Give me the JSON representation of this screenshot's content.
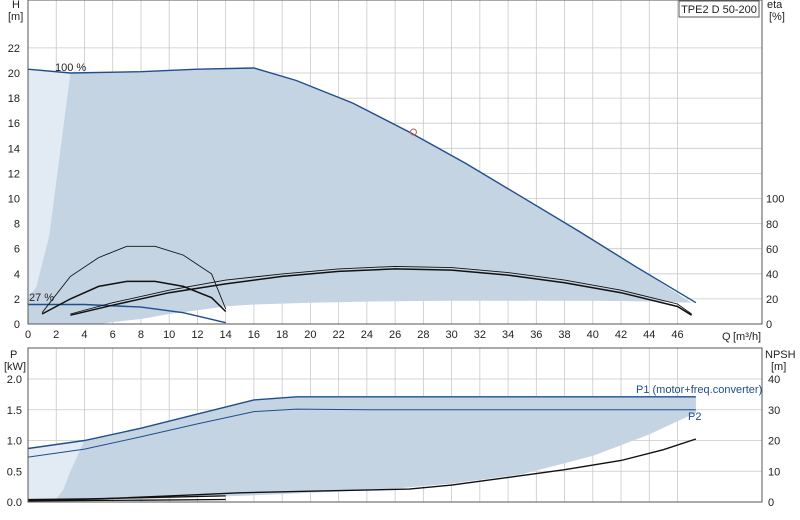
{
  "chart_data": [
    {
      "type": "line",
      "name": "head-efficiency",
      "title": "TPE2 D 50-200",
      "ylabel": "H",
      "yunit": "[m]",
      "y2label": "eta",
      "y2unit": "[%]",
      "xlabel": "Q",
      "xunit": "[m³/h]",
      "xlim": [
        0,
        48
      ],
      "ylim": [
        0,
        24
      ],
      "y2lim": [
        0,
        100
      ],
      "xticks": [
        "0",
        "2",
        "4",
        "6",
        "8",
        "10",
        "12",
        "14",
        "16",
        "18",
        "20",
        "22",
        "24",
        "26",
        "28",
        "30",
        "32",
        "34",
        "36",
        "38",
        "40",
        "42",
        "44",
        "46"
      ],
      "yticks": [
        "0",
        "2",
        "4",
        "6",
        "8",
        "10",
        "12",
        "14",
        "16",
        "18",
        "20",
        "22"
      ],
      "y2ticks": [
        "0",
        "20",
        "40",
        "60",
        "80",
        "100"
      ],
      "grid": true,
      "annotations": {
        "curve_max": "100 %",
        "curve_min": "27 %"
      },
      "colors": {
        "head": "#1f4e8c",
        "area": "#c5d4e3",
        "area_light": "#e2ebf3",
        "eta": "#111111",
        "op_point": "#d9534f"
      },
      "operating_area": [
        [
          0,
          20.3
        ],
        [
          3,
          20
        ],
        [
          8,
          20.1
        ],
        [
          12,
          20.3
        ],
        [
          16,
          20.4
        ],
        [
          19,
          19.4
        ],
        [
          23,
          17.6
        ],
        [
          27,
          15.3
        ],
        [
          31,
          12.8
        ],
        [
          35,
          10.1
        ],
        [
          39,
          7.4
        ],
        [
          43,
          4.6
        ],
        [
          47,
          1.7
        ],
        [
          47,
          1.7
        ],
        [
          44,
          1.8
        ],
        [
          40,
          1.85
        ],
        [
          35,
          1.85
        ],
        [
          30,
          1.85
        ],
        [
          25,
          1.8
        ],
        [
          20,
          1.7
        ],
        [
          16,
          1.55
        ],
        [
          14,
          1.4
        ],
        [
          12,
          1.1
        ],
        [
          10,
          0.8
        ],
        [
          8,
          0.4
        ],
        [
          6,
          0.15
        ],
        [
          5,
          0
        ],
        [
          0,
          0
        ]
      ],
      "operating_area_light": [
        [
          0,
          20.3
        ],
        [
          3,
          20
        ],
        [
          1.5,
          7
        ],
        [
          0.6,
          3
        ],
        [
          0,
          2
        ]
      ],
      "head_series": [
        {
          "values": [
            [
              0,
              20.3
            ],
            [
              3,
              20
            ],
            [
              8,
              20.1
            ],
            [
              12,
              20.3
            ],
            [
              16,
              20.4
            ],
            [
              19,
              19.4
            ],
            [
              23,
              17.6
            ],
            [
              27,
              15.3
            ],
            [
              31,
              12.8
            ],
            [
              35,
              10.1
            ],
            [
              39,
              7.4
            ],
            [
              43,
              4.6
            ],
            [
              47.3,
              1.7
            ]
          ]
        },
        {
          "values": [
            [
              0,
              1.55
            ],
            [
              4,
              1.55
            ],
            [
              8,
              1.35
            ],
            [
              11,
              0.9
            ],
            [
              14,
              0.1
            ]
          ]
        }
      ],
      "eta_series": [
        {
          "axis": "y2",
          "values": [
            [
              1,
              8
            ],
            [
              3,
              20
            ],
            [
              5,
              30
            ],
            [
              7,
              34
            ],
            [
              9,
              34
            ],
            [
              11,
              30
            ],
            [
              13,
              21
            ],
            [
              14,
              10
            ]
          ]
        },
        {
          "axis": "y2",
          "values": [
            [
              1,
              9
            ],
            [
              3,
              38
            ],
            [
              5,
              53
            ],
            [
              7,
              62
            ],
            [
              9,
              62
            ],
            [
              11,
              55
            ],
            [
              13,
              40
            ],
            [
              14,
              12
            ]
          ]
        },
        {
          "axis": "y2",
          "values": [
            [
              3,
              7
            ],
            [
              6,
              15
            ],
            [
              10,
              25
            ],
            [
              14,
              32
            ],
            [
              18,
              38
            ],
            [
              22,
              42
            ],
            [
              26,
              44
            ],
            [
              30,
              43
            ],
            [
              34,
              39
            ],
            [
              38,
              33
            ],
            [
              42,
              25
            ],
            [
              46,
              14
            ],
            [
              47,
              7
            ]
          ]
        },
        {
          "axis": "y2",
          "values": [
            [
              3,
              8
            ],
            [
              6,
              17
            ],
            [
              10,
              27
            ],
            [
              14,
              35
            ],
            [
              18,
              40
            ],
            [
              22,
              44
            ],
            [
              26,
              46
            ],
            [
              30,
              45
            ],
            [
              34,
              41
            ],
            [
              38,
              35
            ],
            [
              42,
              27
            ],
            [
              46,
              16
            ],
            [
              47,
              8
            ]
          ]
        }
      ],
      "operating_point": {
        "x": 27.3,
        "y": 15.3
      }
    },
    {
      "type": "line",
      "name": "power-npsh",
      "ylabel": "P",
      "yunit": "[kW]",
      "y2label": "NPSH",
      "y2unit": "[m]",
      "xlim": [
        0,
        48
      ],
      "ylim": [
        0,
        2.0
      ],
      "y2lim": [
        0,
        40
      ],
      "yticks": [
        "0.0",
        "0.5",
        "1.0",
        "1.5",
        "2.0"
      ],
      "y2ticks": [
        "0",
        "10",
        "20",
        "30",
        "40"
      ],
      "grid": true,
      "colors": {
        "p1": "#1f4e8c",
        "p2": "#1f4e8c",
        "npsh": "#111111",
        "area": "#c5d4e3",
        "area_light": "#e2ebf3"
      },
      "series": [
        {
          "name": "P1 (motor+freq.converter)",
          "values": [
            [
              0,
              0.87
            ],
            [
              4,
              1.0
            ],
            [
              8,
              1.2
            ],
            [
              12,
              1.43
            ],
            [
              16,
              1.66
            ],
            [
              19,
              1.71
            ],
            [
              24,
              1.71
            ],
            [
              30,
              1.71
            ],
            [
              40,
              1.71
            ],
            [
              47.3,
              1.71
            ]
          ]
        },
        {
          "name": "P2",
          "values": [
            [
              0,
              0.73
            ],
            [
              4,
              0.86
            ],
            [
              8,
              1.06
            ],
            [
              12,
              1.27
            ],
            [
              16,
              1.47
            ],
            [
              19,
              1.51
            ],
            [
              24,
              1.5
            ],
            [
              30,
              1.5
            ],
            [
              40,
              1.5
            ],
            [
              47.3,
              1.5
            ]
          ]
        },
        {
          "values": [
            [
              0,
              0.04
            ],
            [
              4,
              0.05
            ],
            [
              8,
              0.07
            ],
            [
              14,
              0.1
            ]
          ]
        },
        {
          "values": [
            [
              0,
              0.02
            ],
            [
              4,
              0.025
            ],
            [
              8,
              0.03
            ],
            [
              14,
              0.04
            ]
          ]
        },
        {
          "axis": "y2",
          "values": [
            [
              0,
              0.5
            ],
            [
              5,
              1
            ],
            [
              10,
              2
            ],
            [
              15,
              3
            ],
            [
              20,
              3.5
            ],
            [
              27,
              4.2
            ],
            [
              30,
              5.5
            ],
            [
              34,
              8
            ],
            [
              38,
              10.5
            ],
            [
              42,
              13.5
            ],
            [
              45,
              17
            ],
            [
              47.3,
              20.5
            ]
          ]
        }
      ],
      "operating_area": [
        [
          0,
          0.87
        ],
        [
          4,
          1.0
        ],
        [
          8,
          1.2
        ],
        [
          12,
          1.43
        ],
        [
          16,
          1.66
        ],
        [
          19,
          1.71
        ],
        [
          24,
          1.71
        ],
        [
          30,
          1.71
        ],
        [
          40,
          1.71
        ],
        [
          47.3,
          1.71
        ],
        [
          47.3,
          1.45
        ],
        [
          44,
          1.1
        ],
        [
          40,
          0.75
        ],
        [
          35,
          0.45
        ],
        [
          30,
          0.3
        ],
        [
          25,
          0.2
        ],
        [
          20,
          0.15
        ],
        [
          15,
          0.1
        ],
        [
          10,
          0.06
        ],
        [
          5,
          0.04
        ],
        [
          0,
          0.03
        ]
      ],
      "operating_area_light": [
        [
          0,
          0.87
        ],
        [
          4,
          1.0
        ],
        [
          3,
          0.5
        ],
        [
          2.5,
          0.2
        ],
        [
          2,
          0.05
        ],
        [
          0,
          0.03
        ]
      ]
    }
  ]
}
